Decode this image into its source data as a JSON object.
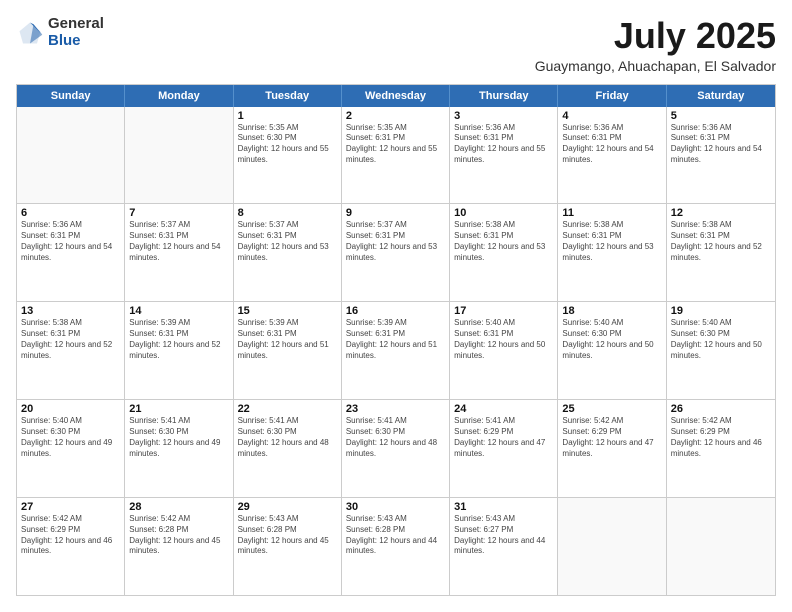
{
  "logo": {
    "general": "General",
    "blue": "Blue"
  },
  "title": "July 2025",
  "subtitle": "Guaymango, Ahuachapan, El Salvador",
  "days_of_week": [
    "Sunday",
    "Monday",
    "Tuesday",
    "Wednesday",
    "Thursday",
    "Friday",
    "Saturday"
  ],
  "weeks": [
    [
      {
        "day": "",
        "sunrise": "",
        "sunset": "",
        "daylight": ""
      },
      {
        "day": "",
        "sunrise": "",
        "sunset": "",
        "daylight": ""
      },
      {
        "day": "1",
        "sunrise": "Sunrise: 5:35 AM",
        "sunset": "Sunset: 6:30 PM",
        "daylight": "Daylight: 12 hours and 55 minutes."
      },
      {
        "day": "2",
        "sunrise": "Sunrise: 5:35 AM",
        "sunset": "Sunset: 6:31 PM",
        "daylight": "Daylight: 12 hours and 55 minutes."
      },
      {
        "day": "3",
        "sunrise": "Sunrise: 5:36 AM",
        "sunset": "Sunset: 6:31 PM",
        "daylight": "Daylight: 12 hours and 55 minutes."
      },
      {
        "day": "4",
        "sunrise": "Sunrise: 5:36 AM",
        "sunset": "Sunset: 6:31 PM",
        "daylight": "Daylight: 12 hours and 54 minutes."
      },
      {
        "day": "5",
        "sunrise": "Sunrise: 5:36 AM",
        "sunset": "Sunset: 6:31 PM",
        "daylight": "Daylight: 12 hours and 54 minutes."
      }
    ],
    [
      {
        "day": "6",
        "sunrise": "Sunrise: 5:36 AM",
        "sunset": "Sunset: 6:31 PM",
        "daylight": "Daylight: 12 hours and 54 minutes."
      },
      {
        "day": "7",
        "sunrise": "Sunrise: 5:37 AM",
        "sunset": "Sunset: 6:31 PM",
        "daylight": "Daylight: 12 hours and 54 minutes."
      },
      {
        "day": "8",
        "sunrise": "Sunrise: 5:37 AM",
        "sunset": "Sunset: 6:31 PM",
        "daylight": "Daylight: 12 hours and 53 minutes."
      },
      {
        "day": "9",
        "sunrise": "Sunrise: 5:37 AM",
        "sunset": "Sunset: 6:31 PM",
        "daylight": "Daylight: 12 hours and 53 minutes."
      },
      {
        "day": "10",
        "sunrise": "Sunrise: 5:38 AM",
        "sunset": "Sunset: 6:31 PM",
        "daylight": "Daylight: 12 hours and 53 minutes."
      },
      {
        "day": "11",
        "sunrise": "Sunrise: 5:38 AM",
        "sunset": "Sunset: 6:31 PM",
        "daylight": "Daylight: 12 hours and 53 minutes."
      },
      {
        "day": "12",
        "sunrise": "Sunrise: 5:38 AM",
        "sunset": "Sunset: 6:31 PM",
        "daylight": "Daylight: 12 hours and 52 minutes."
      }
    ],
    [
      {
        "day": "13",
        "sunrise": "Sunrise: 5:38 AM",
        "sunset": "Sunset: 6:31 PM",
        "daylight": "Daylight: 12 hours and 52 minutes."
      },
      {
        "day": "14",
        "sunrise": "Sunrise: 5:39 AM",
        "sunset": "Sunset: 6:31 PM",
        "daylight": "Daylight: 12 hours and 52 minutes."
      },
      {
        "day": "15",
        "sunrise": "Sunrise: 5:39 AM",
        "sunset": "Sunset: 6:31 PM",
        "daylight": "Daylight: 12 hours and 51 minutes."
      },
      {
        "day": "16",
        "sunrise": "Sunrise: 5:39 AM",
        "sunset": "Sunset: 6:31 PM",
        "daylight": "Daylight: 12 hours and 51 minutes."
      },
      {
        "day": "17",
        "sunrise": "Sunrise: 5:40 AM",
        "sunset": "Sunset: 6:31 PM",
        "daylight": "Daylight: 12 hours and 50 minutes."
      },
      {
        "day": "18",
        "sunrise": "Sunrise: 5:40 AM",
        "sunset": "Sunset: 6:30 PM",
        "daylight": "Daylight: 12 hours and 50 minutes."
      },
      {
        "day": "19",
        "sunrise": "Sunrise: 5:40 AM",
        "sunset": "Sunset: 6:30 PM",
        "daylight": "Daylight: 12 hours and 50 minutes."
      }
    ],
    [
      {
        "day": "20",
        "sunrise": "Sunrise: 5:40 AM",
        "sunset": "Sunset: 6:30 PM",
        "daylight": "Daylight: 12 hours and 49 minutes."
      },
      {
        "day": "21",
        "sunrise": "Sunrise: 5:41 AM",
        "sunset": "Sunset: 6:30 PM",
        "daylight": "Daylight: 12 hours and 49 minutes."
      },
      {
        "day": "22",
        "sunrise": "Sunrise: 5:41 AM",
        "sunset": "Sunset: 6:30 PM",
        "daylight": "Daylight: 12 hours and 48 minutes."
      },
      {
        "day": "23",
        "sunrise": "Sunrise: 5:41 AM",
        "sunset": "Sunset: 6:30 PM",
        "daylight": "Daylight: 12 hours and 48 minutes."
      },
      {
        "day": "24",
        "sunrise": "Sunrise: 5:41 AM",
        "sunset": "Sunset: 6:29 PM",
        "daylight": "Daylight: 12 hours and 47 minutes."
      },
      {
        "day": "25",
        "sunrise": "Sunrise: 5:42 AM",
        "sunset": "Sunset: 6:29 PM",
        "daylight": "Daylight: 12 hours and 47 minutes."
      },
      {
        "day": "26",
        "sunrise": "Sunrise: 5:42 AM",
        "sunset": "Sunset: 6:29 PM",
        "daylight": "Daylight: 12 hours and 46 minutes."
      }
    ],
    [
      {
        "day": "27",
        "sunrise": "Sunrise: 5:42 AM",
        "sunset": "Sunset: 6:29 PM",
        "daylight": "Daylight: 12 hours and 46 minutes."
      },
      {
        "day": "28",
        "sunrise": "Sunrise: 5:42 AM",
        "sunset": "Sunset: 6:28 PM",
        "daylight": "Daylight: 12 hours and 45 minutes."
      },
      {
        "day": "29",
        "sunrise": "Sunrise: 5:43 AM",
        "sunset": "Sunset: 6:28 PM",
        "daylight": "Daylight: 12 hours and 45 minutes."
      },
      {
        "day": "30",
        "sunrise": "Sunrise: 5:43 AM",
        "sunset": "Sunset: 6:28 PM",
        "daylight": "Daylight: 12 hours and 44 minutes."
      },
      {
        "day": "31",
        "sunrise": "Sunrise: 5:43 AM",
        "sunset": "Sunset: 6:27 PM",
        "daylight": "Daylight: 12 hours and 44 minutes."
      },
      {
        "day": "",
        "sunrise": "",
        "sunset": "",
        "daylight": ""
      },
      {
        "day": "",
        "sunrise": "",
        "sunset": "",
        "daylight": ""
      }
    ]
  ]
}
